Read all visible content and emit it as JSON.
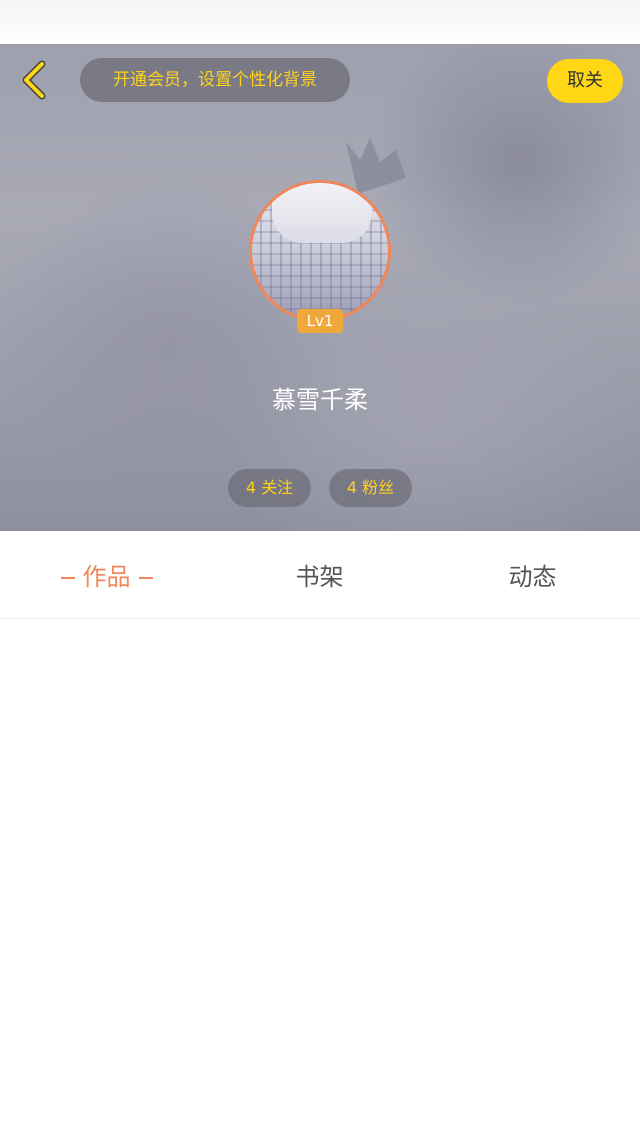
{
  "header": {
    "vip_banner": "开通会员，设置个性化背景",
    "follow_button": "取关"
  },
  "profile": {
    "level": "Lv1",
    "username": "慕雪千柔",
    "following": "4 关注",
    "fans": "4 粉丝"
  },
  "tabs": [
    {
      "label": "作品",
      "active": true
    },
    {
      "label": "书架",
      "active": false
    },
    {
      "label": "动态",
      "active": false
    }
  ],
  "colors": {
    "accent": "#f0875a",
    "highlight": "#ffd714",
    "level_badge": "#f0a83a"
  },
  "icons": {
    "back": "chevron-left-icon",
    "crown": "crown-icon"
  }
}
